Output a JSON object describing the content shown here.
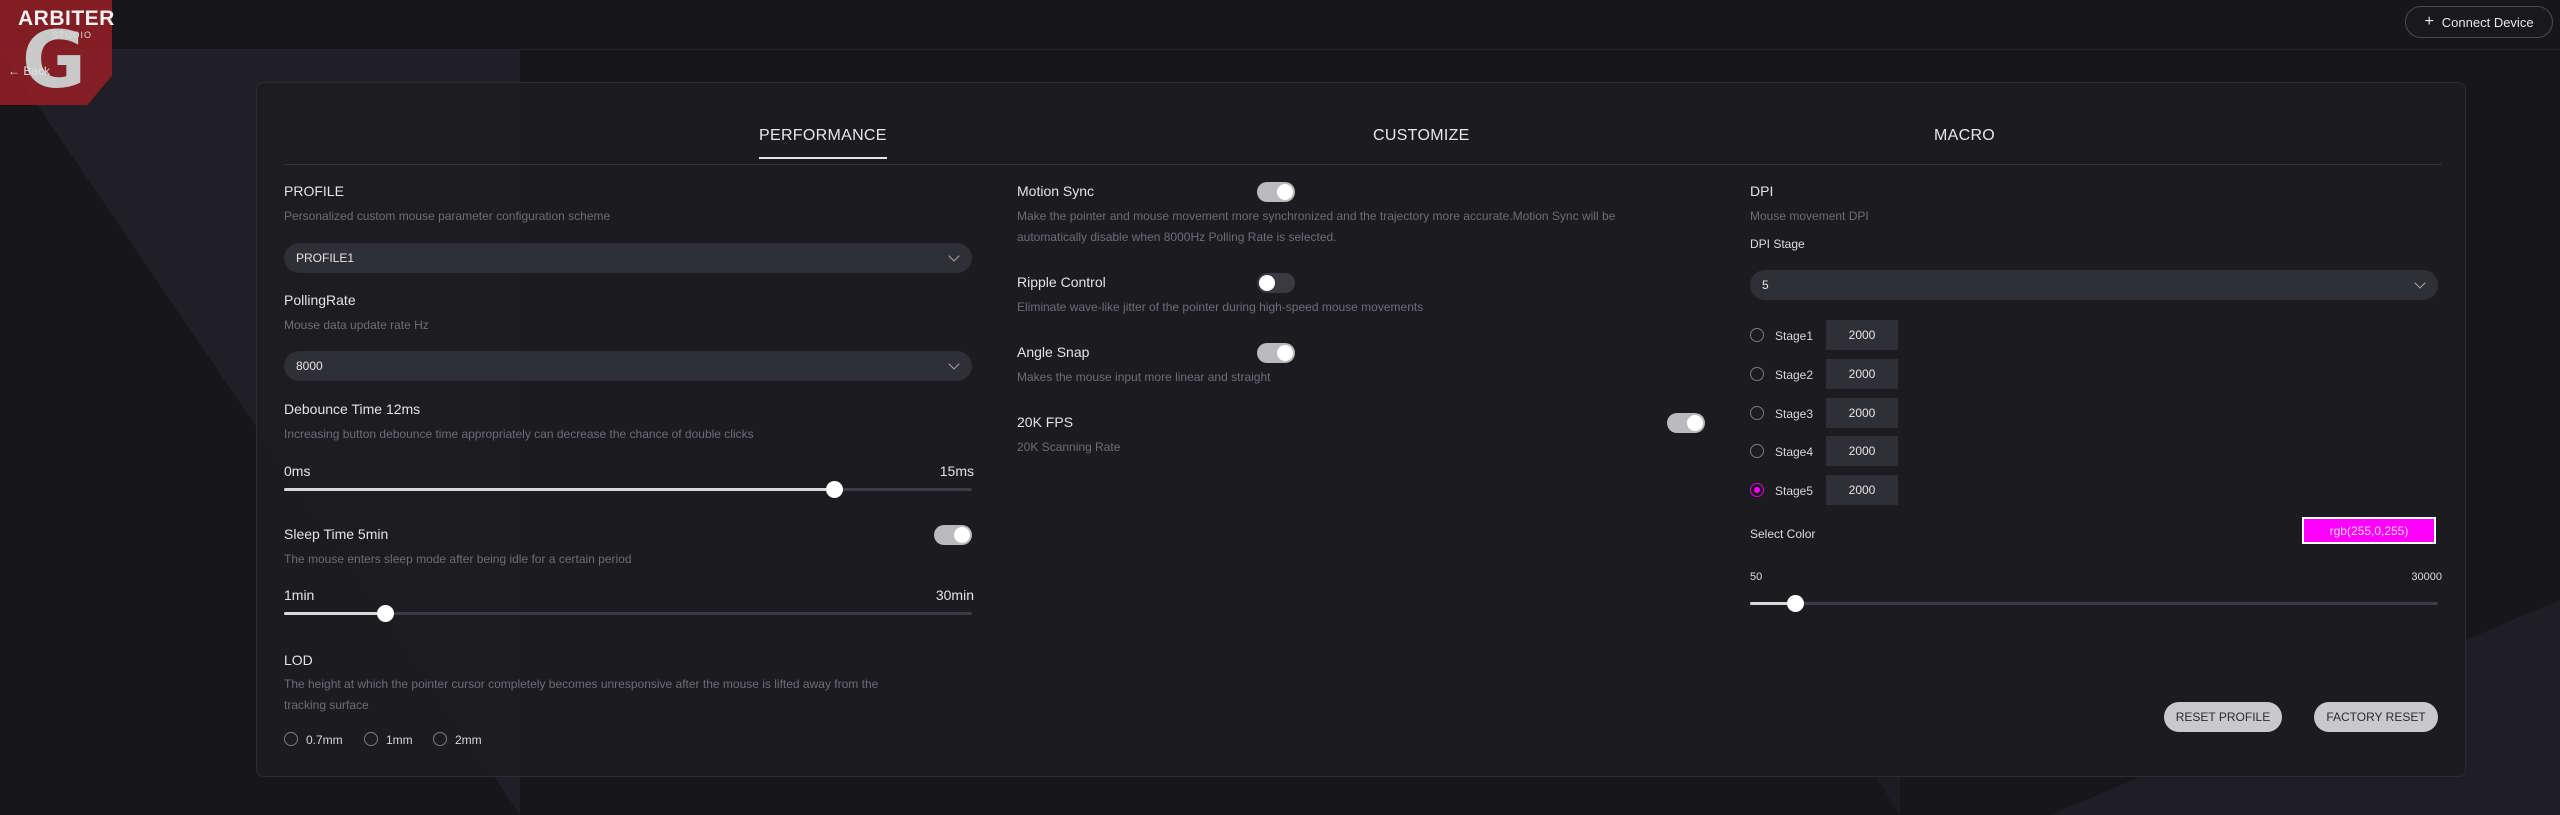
{
  "app": {
    "logo_text": "ARBITER",
    "logo_sub": "STUDIO",
    "back_label": "Back",
    "connect_label": "Connect Device"
  },
  "tabs": [
    {
      "label": "PERFORMANCE"
    },
    {
      "label": "CUSTOMIZE"
    },
    {
      "label": "MACRO"
    }
  ],
  "profile": {
    "title": "PROFILE",
    "desc": "Personalized custom mouse parameter configuration scheme",
    "value": "PROFILE1"
  },
  "polling": {
    "title": "PollingRate",
    "desc": "Mouse data update rate Hz",
    "value": "8000"
  },
  "debounce": {
    "title": "Debounce Time 12ms",
    "desc": "Increasing button debounce time appropriately can decrease the chance of double clicks",
    "min_label": "0ms",
    "max_label": "15ms",
    "level": 0.8
  },
  "sleep": {
    "title": "Sleep Time 5min",
    "desc": "The mouse enters sleep mode after being idle for a certain period",
    "min_label": "1min",
    "max_label": "30min",
    "level": 0.147,
    "toggle_on": true
  },
  "lod": {
    "title": "LOD",
    "desc_line1": "The height at which the pointer cursor completely becomes unresponsive after the mouse is lifted away from the",
    "desc_line2": "tracking surface",
    "options": [
      "0.7mm",
      "1mm",
      "2mm"
    ]
  },
  "motion_sync": {
    "title": "Motion Sync",
    "desc_line1": "Make the pointer and mouse movement more synchronized and the trajectory more accurate.Motion Sync will be",
    "desc_line2": "automatically disable when 8000Hz Polling Rate is selected.",
    "on": true
  },
  "ripple": {
    "title": "Ripple Control",
    "desc": "Eliminate wave-like jitter of the pointer during high-speed mouse movements",
    "on": false
  },
  "angle_snap": {
    "title": "Angle Snap",
    "desc": "Makes the mouse input more linear and straight",
    "on": true
  },
  "fps": {
    "title": "20K FPS",
    "desc": "20K Scanning Rate",
    "on": true
  },
  "dpi": {
    "title": "DPI",
    "desc": "Mouse movement DPI",
    "stage_label": "DPI Stage",
    "stage_value": "5",
    "stages": [
      {
        "label": "Stage1",
        "value": "2000"
      },
      {
        "label": "Stage2",
        "value": "2000"
      },
      {
        "label": "Stage3",
        "value": "2000"
      },
      {
        "label": "Stage4",
        "value": "2000"
      },
      {
        "label": "Stage5",
        "value": "2000"
      }
    ],
    "selected_stage": 5,
    "color_label": "Select Color",
    "color_value": "rgb(255,0,255)",
    "color_hex": "#ff00ff",
    "min_label": "50",
    "max_label": "30000",
    "level": 0.065
  },
  "buttons": {
    "reset_profile": "RESET PROFILE",
    "factory_reset": "FACTORY RESET"
  }
}
